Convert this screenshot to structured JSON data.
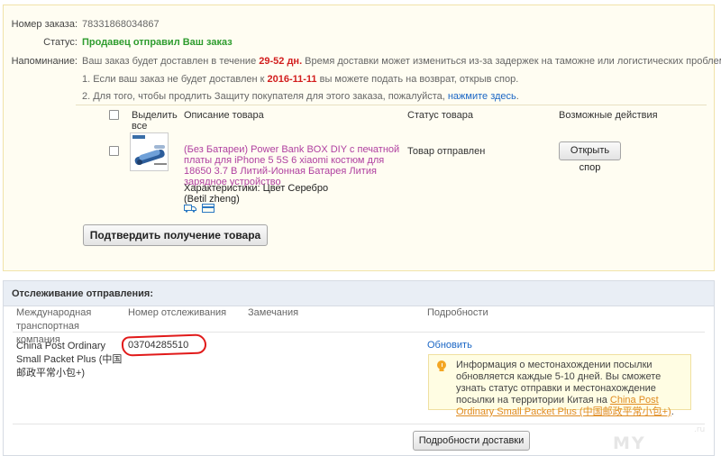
{
  "order": {
    "number_label": "Номер заказа:",
    "number_value": "78331868034867",
    "status_label": "Статус:",
    "status_value": "Продавец отправил Ваш заказ",
    "reminder_label": "Напоминание:",
    "reminder_part1": "Ваш заказ будет доставлен в течение ",
    "reminder_days": "29-52 дн.",
    "reminder_part2": " Время доставки может измениться из-за задержек на таможне или логистических проблем.",
    "note1_part1": "1. Если ваш заказ не будет доставлен к ",
    "note1_date": "2016-11-11",
    "note1_part2": " вы можете подать на возврат, открыв спор.",
    "note2_part1": "2. Для того, чтобы продлить Защиту покупателя для этого заказа, пожалуйста, ",
    "note2_link": "нажмите здесь",
    "note2_end": "."
  },
  "products_table": {
    "headers": {
      "select_all": "Выделить все",
      "description": "Описание товара",
      "status": "Статус товара",
      "actions": "Возможные действия"
    },
    "item": {
      "title": "(Без Батареи) Power Bank BOX DIY с печатной платы для iPhone 5 5S 6 xiaomi костюм для 18650 3.7 В Литий-Ионная Батарея Лития зарядное устройство",
      "attr_line1": "Характеристики: Цвет Серебро",
      "attr_line2": "(Betil zheng)",
      "status": "Товар отправлен",
      "action_button": "Открыть спор",
      "icons": [
        "truck-icon",
        "card-icon"
      ]
    },
    "confirm_button": "Подтвердить получение товара"
  },
  "tracking": {
    "title": "Отслеживание отправления:",
    "headers": {
      "company": "Международная транспортная компания",
      "number": "Номер отслеживания",
      "remarks": "Замечания",
      "details": "Подробности"
    },
    "row": {
      "company": "China Post Ordinary Small Packet Plus (中国邮政平常小包+)",
      "number": "03704285510",
      "refresh_link": "Обновить",
      "info_text": "Информация о местонахождении посылки обновляется каждые 5-10 дней. Вы сможете узнать статус отправки и местонахождение посылки на территории Китая на ",
      "info_link": "China Post Ordinary Small Packet Plus (中国邮政平常小包+)",
      "info_end": "."
    },
    "details_button": "Подробности доставки"
  },
  "colors": {
    "status_green": "#2e9c2e",
    "highlight_red": "#d21e1e",
    "link_blue": "#1a66c5",
    "product_link": "#b040a0",
    "info_link": "#e08b1f",
    "annotation_red": "#e11a1a"
  },
  "watermark": {
    "main": "MY",
    "small": ".ru"
  }
}
